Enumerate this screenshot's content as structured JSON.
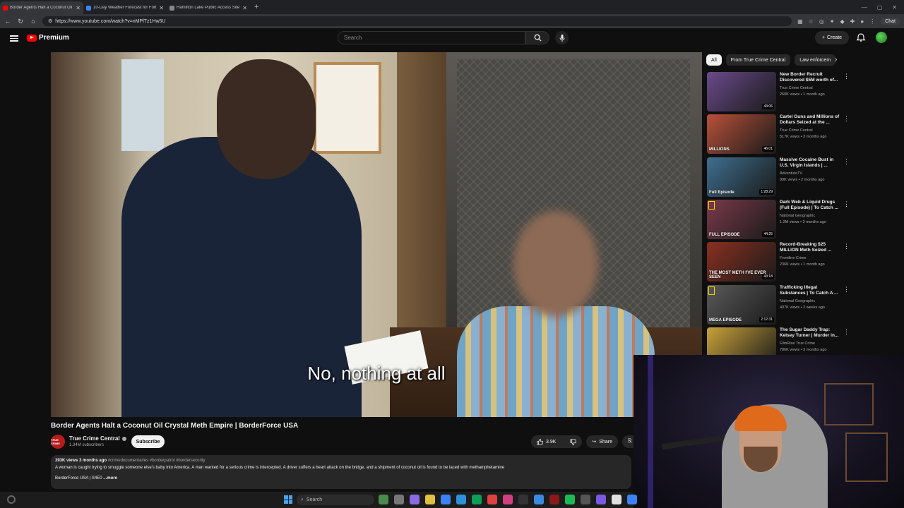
{
  "browser": {
    "tabs": [
      {
        "title": "Border Agents Halt a Coconut Oil",
        "favicon": "youtube-icon",
        "active": true
      },
      {
        "title": "10-Day Weather Forecast for Fort",
        "favicon": "weather-icon",
        "active": false
      },
      {
        "title": "Hamilton Lake Public Access Site",
        "favicon": "page-icon",
        "active": false
      }
    ],
    "url": "https://www.youtube.com/watch?v=nMPlTz1Hw5U",
    "chat_label": "Chat"
  },
  "youtube": {
    "logo_text": "Premium",
    "search_placeholder": "Search",
    "create_label": "Create"
  },
  "video": {
    "caption": "No, nothing at all",
    "title": "Border Agents Halt a Coconut Oil Crystal Meth Empire | BorderForce USA",
    "channel": "True Crime Central",
    "channel_avatar_text": "TRUE CRIME",
    "subscribers": "1.34M subscribers",
    "subscribe_label": "Subscribe",
    "likes": "3.9K",
    "share_label": "Share",
    "views": "393K views",
    "age": "3 months ago",
    "hashtags": "#crimedocumentaries #borderpatrol #bordersecurity",
    "description": "A woman is caught trying to smuggle someone else's baby into America. A man wanted for a serious crime is intercepted. A driver suffers a heart attack on the bridge, and a shipment of coconut oil is found to be laced with methamphetamine",
    "desc_line2": "BorderForce USA | S4E0",
    "more_label": "...more"
  },
  "chips": [
    "All",
    "From True Crime Central",
    "Law enforcem"
  ],
  "recommendations": [
    {
      "title": "New Border Recruit Discovered $5M worth of...",
      "channel": "True Crime Central",
      "meta": "260K views • 1 month ago",
      "duration": "43:06",
      "thumb_label": "",
      "color": "#6a4a8a"
    },
    {
      "title": "Cartel Guns and Millions of Dollars Seized at the ...",
      "channel": "True Crime Central",
      "meta": "517K views • 3 months ago",
      "duration": "46:01",
      "thumb_label": "MILLIONS.",
      "color": "#b8513a"
    },
    {
      "title": "Massive Cocaine Bust in U.S. Virgin Islands | ...",
      "channel": "AdventureTV",
      "meta": "99K views • 2 months ago",
      "duration": "1:28:29",
      "thumb_label": "Full Episode",
      "color": "#3f6f8f"
    },
    {
      "title": "Dark Web & Liquid Drugs (Full Episode) | To Catch ...",
      "channel": "National Geographic",
      "meta": "1.2M views • 3 months ago",
      "duration": "44:25",
      "thumb_label": "FULL EPISODE",
      "color": "#7a3a4a"
    },
    {
      "title": "Record-Breaking $25 MILLION Meth Seized ...",
      "channel": "Frontline Crime",
      "meta": "236K views • 1 month ago",
      "duration": "43:18",
      "thumb_label": "THE MOST METH I'VE EVER SEEN",
      "color": "#8a3020"
    },
    {
      "title": "Trafficking Illegal Substances | To Catch A ...",
      "channel": "National Geographic",
      "meta": "407K views • 2 weeks ago",
      "duration": "2:12:31",
      "thumb_label": "MEGA EPISODE",
      "color": "#5a5a5a"
    },
    {
      "title": "The Sugar Daddy Trap: Kelsey Turner | Murder in...",
      "channel": "FilmRise True Crime",
      "meta": "786K views • 3 months ago",
      "duration": "",
      "thumb_label": "",
      "color": "#c9a23a"
    }
  ],
  "taskbar": {
    "search_placeholder": "Search",
    "app_colors": [
      "#4a8a4a",
      "#777",
      "#8a6ae0",
      "#e0c040",
      "#3b82f6",
      "#2f8fd8",
      "#0f9d58",
      "#e04040",
      "#d04080",
      "#333",
      "#3a8ae0",
      "#8a1a1a",
      "#1db954",
      "#555",
      "#7a5ae0",
      "#e0e0e0",
      "#3b82f6"
    ]
  }
}
